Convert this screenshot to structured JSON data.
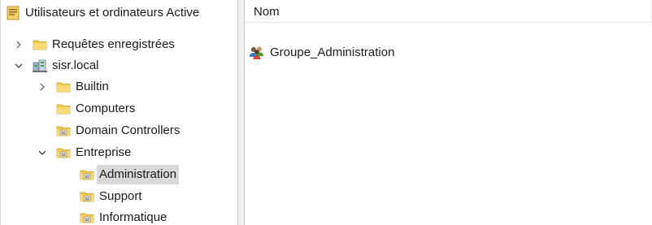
{
  "tree": {
    "root": {
      "label": "Utilisateurs et ordinateurs Active",
      "icon": "aduc-console-icon"
    },
    "items": [
      {
        "label": "Requêtes enregistrées",
        "icon": "folder-icon",
        "expander": "collapsed"
      },
      {
        "label": "sisr.local",
        "icon": "domain-icon",
        "expander": "expanded"
      },
      {
        "label": "Builtin",
        "icon": "folder-icon",
        "expander": "collapsed"
      },
      {
        "label": "Computers",
        "icon": "folder-icon",
        "expander": "none"
      },
      {
        "label": "Domain Controllers",
        "icon": "ou-icon",
        "expander": "none"
      },
      {
        "label": "Entreprise",
        "icon": "ou-icon",
        "expander": "expanded"
      },
      {
        "label": "Administration",
        "icon": "ou-icon",
        "expander": "none",
        "selected": true
      },
      {
        "label": "Support",
        "icon": "ou-icon",
        "expander": "none"
      },
      {
        "label": "Informatique",
        "icon": "ou-icon",
        "expander": "none"
      }
    ]
  },
  "list": {
    "columns": [
      "Nom"
    ],
    "rows": [
      {
        "name": "Groupe_Administration",
        "icon": "group-icon"
      }
    ]
  },
  "colors": {
    "selection": "#d9d9d9",
    "folder": "#f2c94c",
    "splitter": "#f0f0f0"
  }
}
